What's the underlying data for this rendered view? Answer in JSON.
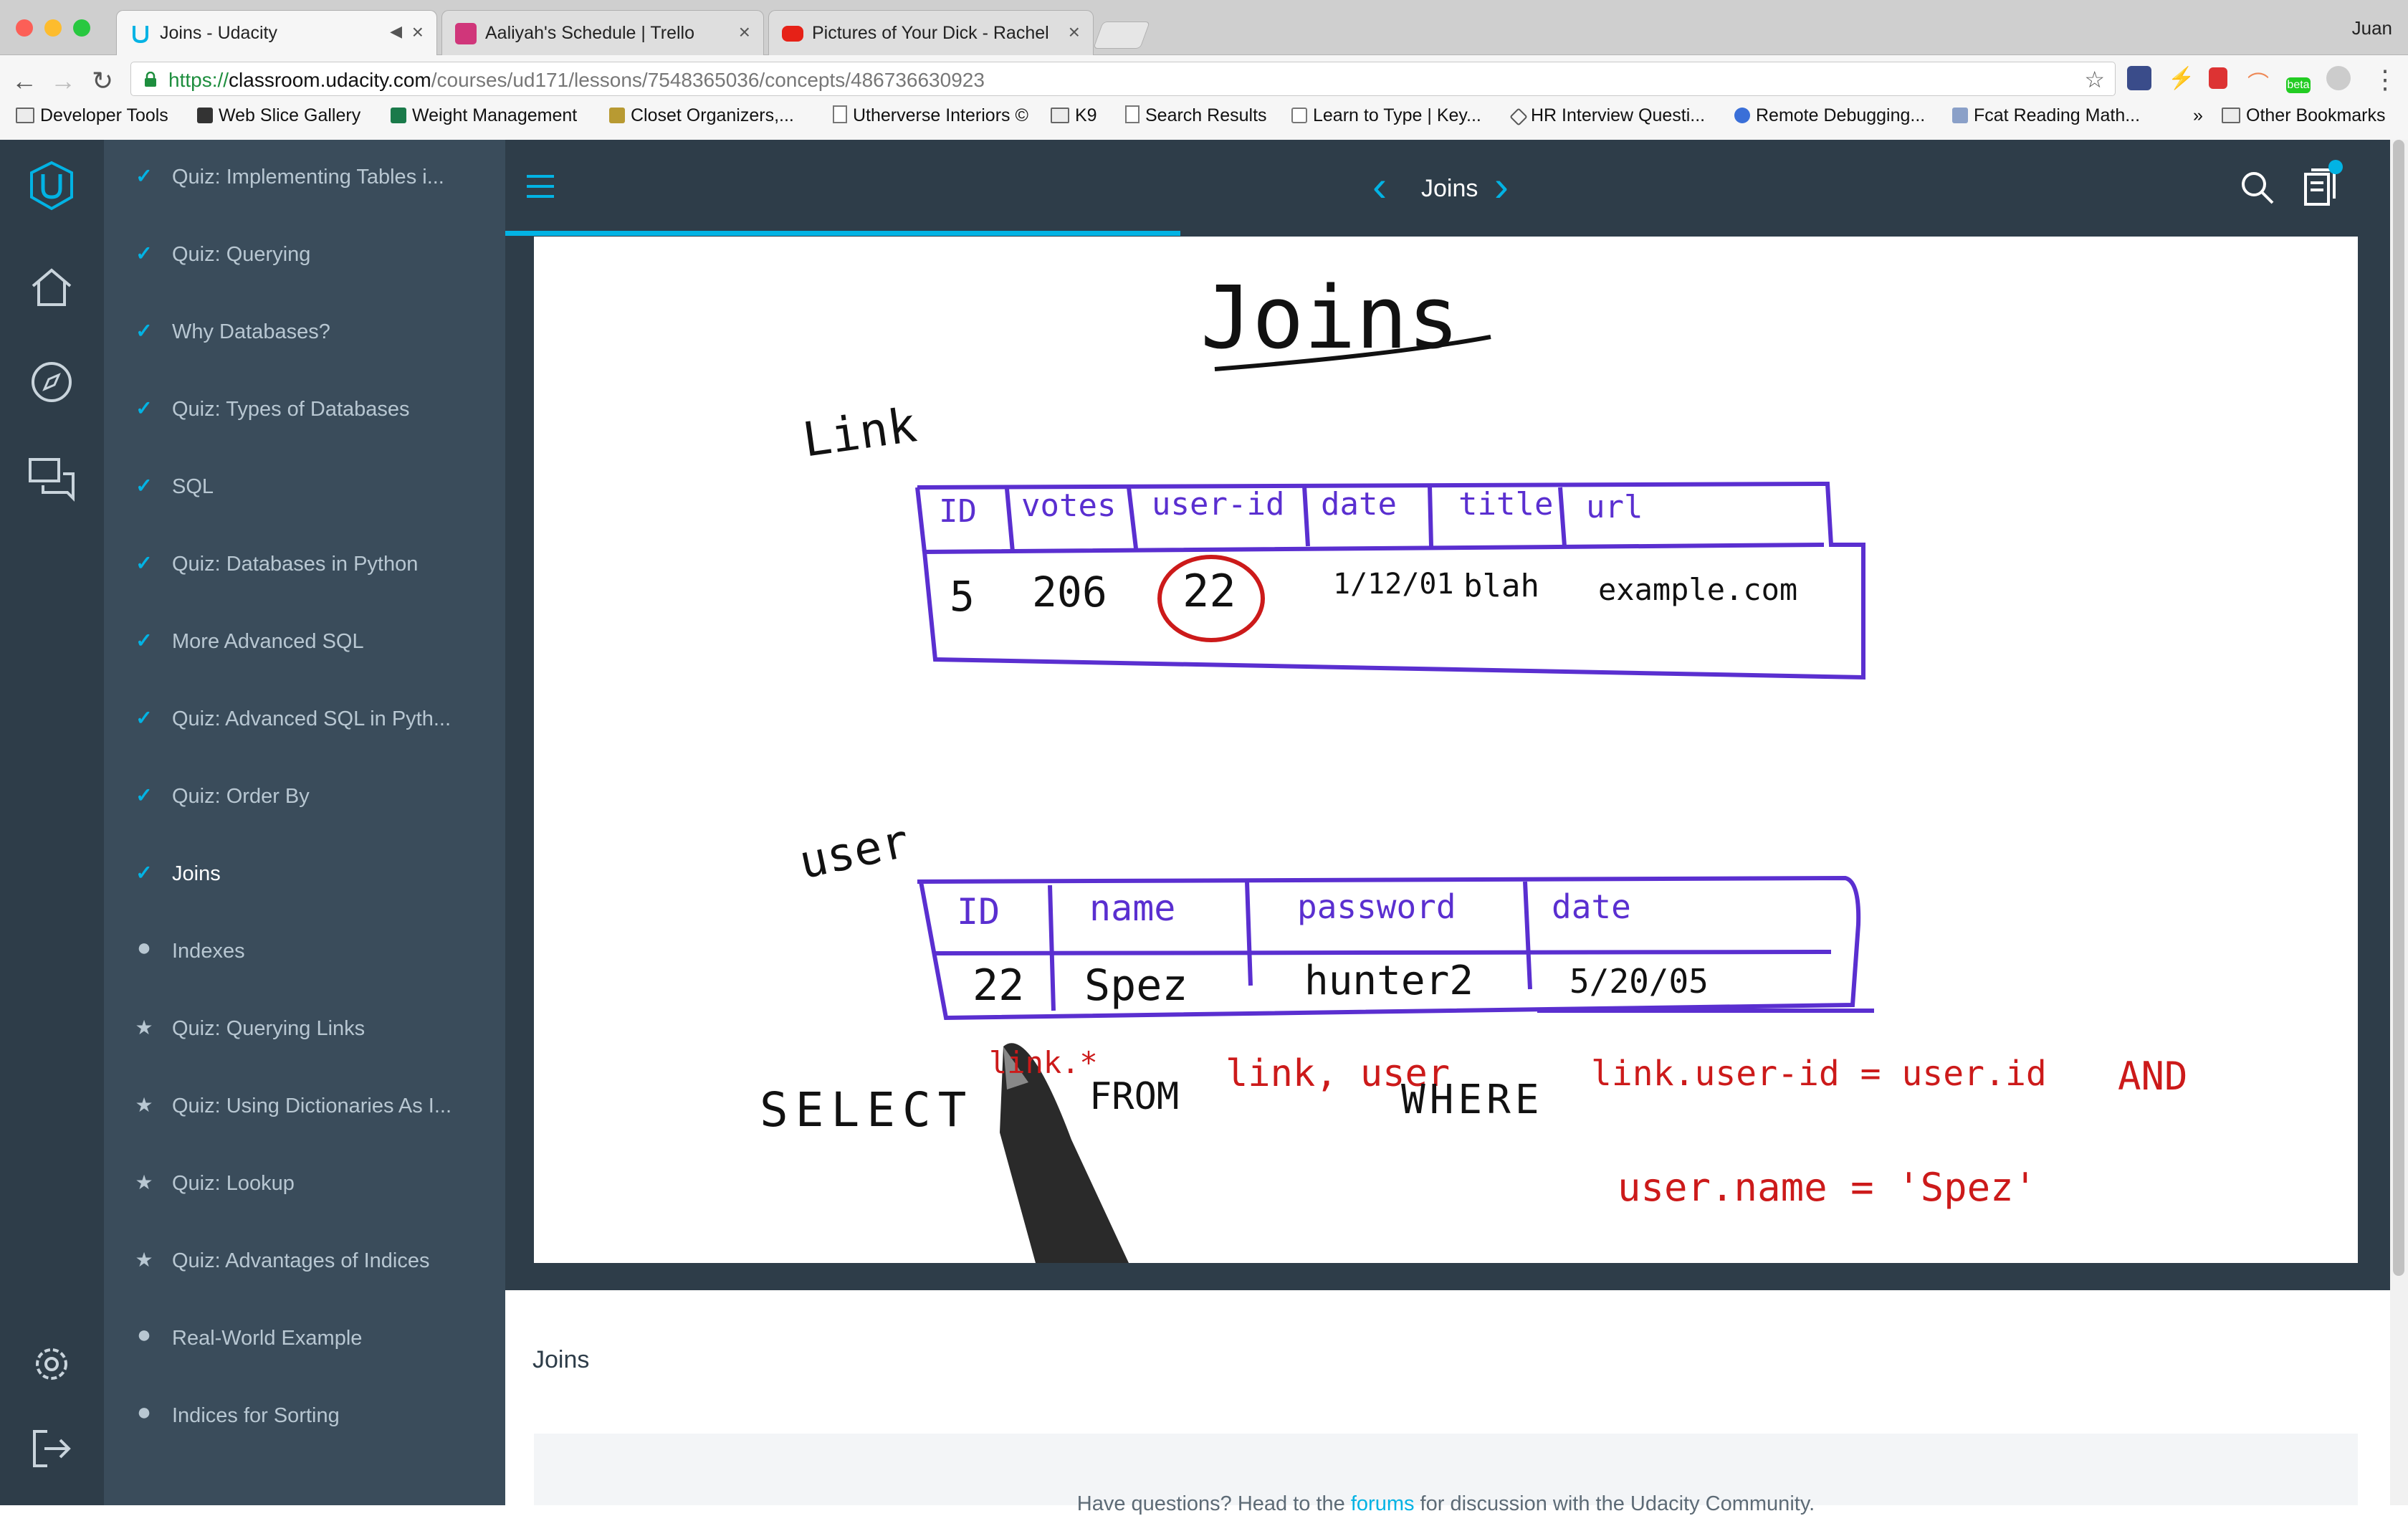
{
  "browser": {
    "profile": "Juan",
    "tabs": [
      {
        "title": "Joins - Udacity",
        "active": true,
        "icon": "udacity-icon",
        "audio": true
      },
      {
        "title": "Aaliyah's Schedule | Trello",
        "active": false,
        "icon": "trello-icon"
      },
      {
        "title": "Pictures of Your Dick - Rachel",
        "active": false,
        "icon": "youtube-icon"
      }
    ],
    "url": {
      "scheme": "https://",
      "host": "classroom.udacity.com",
      "path": "/courses/ud171/lessons/7548365036/concepts/486736630923"
    },
    "bookmarks": [
      {
        "label": "Developer Tools",
        "icon": "folder-icon"
      },
      {
        "label": "Web Slice Gallery",
        "icon": "favicon"
      },
      {
        "label": "Weight Management",
        "icon": "favicon"
      },
      {
        "label": "Closet Organizers,...",
        "icon": "favicon"
      },
      {
        "label": "Utherverse Interiors ©",
        "icon": "page-icon"
      },
      {
        "label": "K9",
        "icon": "folder-icon"
      },
      {
        "label": "Search Results",
        "icon": "page-icon"
      },
      {
        "label": "Learn to Type | Key...",
        "icon": "favicon"
      },
      {
        "label": "HR Interview Questi...",
        "icon": "favicon"
      },
      {
        "label": "Remote Debugging...",
        "icon": "favicon"
      },
      {
        "label": "Fcat Reading Math...",
        "icon": "favicon"
      }
    ],
    "bookmarks_overflow": "»",
    "other_bookmarks": "Other Bookmarks",
    "extension_badge": "beta"
  },
  "app": {
    "title": "Joins",
    "lessons": [
      {
        "label": "Quiz: Implementing Tables i...",
        "status": "done"
      },
      {
        "label": "Quiz: Querying",
        "status": "done"
      },
      {
        "label": "Why Databases?",
        "status": "done"
      },
      {
        "label": "Quiz: Types of Databases",
        "status": "done"
      },
      {
        "label": "SQL",
        "status": "done"
      },
      {
        "label": "Quiz: Databases in Python",
        "status": "done"
      },
      {
        "label": "More Advanced SQL",
        "status": "done"
      },
      {
        "label": "Quiz: Advanced SQL in Pyth...",
        "status": "done"
      },
      {
        "label": "Quiz: Order By",
        "status": "done"
      },
      {
        "label": "Joins",
        "status": "done",
        "current": true
      },
      {
        "label": "Indexes",
        "status": "todo"
      },
      {
        "label": "Quiz: Querying Links",
        "status": "quiz"
      },
      {
        "label": "Quiz: Using Dictionaries As I...",
        "status": "quiz"
      },
      {
        "label": "Quiz: Lookup",
        "status": "quiz"
      },
      {
        "label": "Quiz: Advantages of Indices",
        "status": "quiz"
      },
      {
        "label": "Real-World Example",
        "status": "todo"
      },
      {
        "label": "Indices for Sorting",
        "status": "todo"
      }
    ],
    "lesson_progress_fraction": 0.36,
    "content_title": "Joins",
    "forum": {
      "prefix": "Have questions? Head to the ",
      "link": "forums",
      "suffix": " for discussion with the Udacity Community."
    },
    "colors": {
      "accent": "#02b3e4",
      "rail": "#2e3d49",
      "sidebar": "#3a4c5b"
    }
  },
  "video": {
    "title": "Joins",
    "link_label": "Link",
    "link_headers": [
      "ID",
      "votes",
      "user-id",
      "date",
      "title",
      "url"
    ],
    "link_row": [
      "5",
      "206",
      "22",
      "1/12/01",
      "blah",
      "example.com"
    ],
    "user_label": "user",
    "user_headers": [
      "ID",
      "name",
      "password",
      "date"
    ],
    "user_row": [
      "22",
      "Spez",
      "hunter2",
      "5/20/05"
    ],
    "query": {
      "select": "SELECT",
      "select_cols": "link.*",
      "from": "FROM",
      "from_tables": "link, user",
      "where": "WHERE",
      "cond1": "link.user-id = user.id",
      "and": "AND",
      "cond2": "user.name = 'Spez'"
    }
  }
}
